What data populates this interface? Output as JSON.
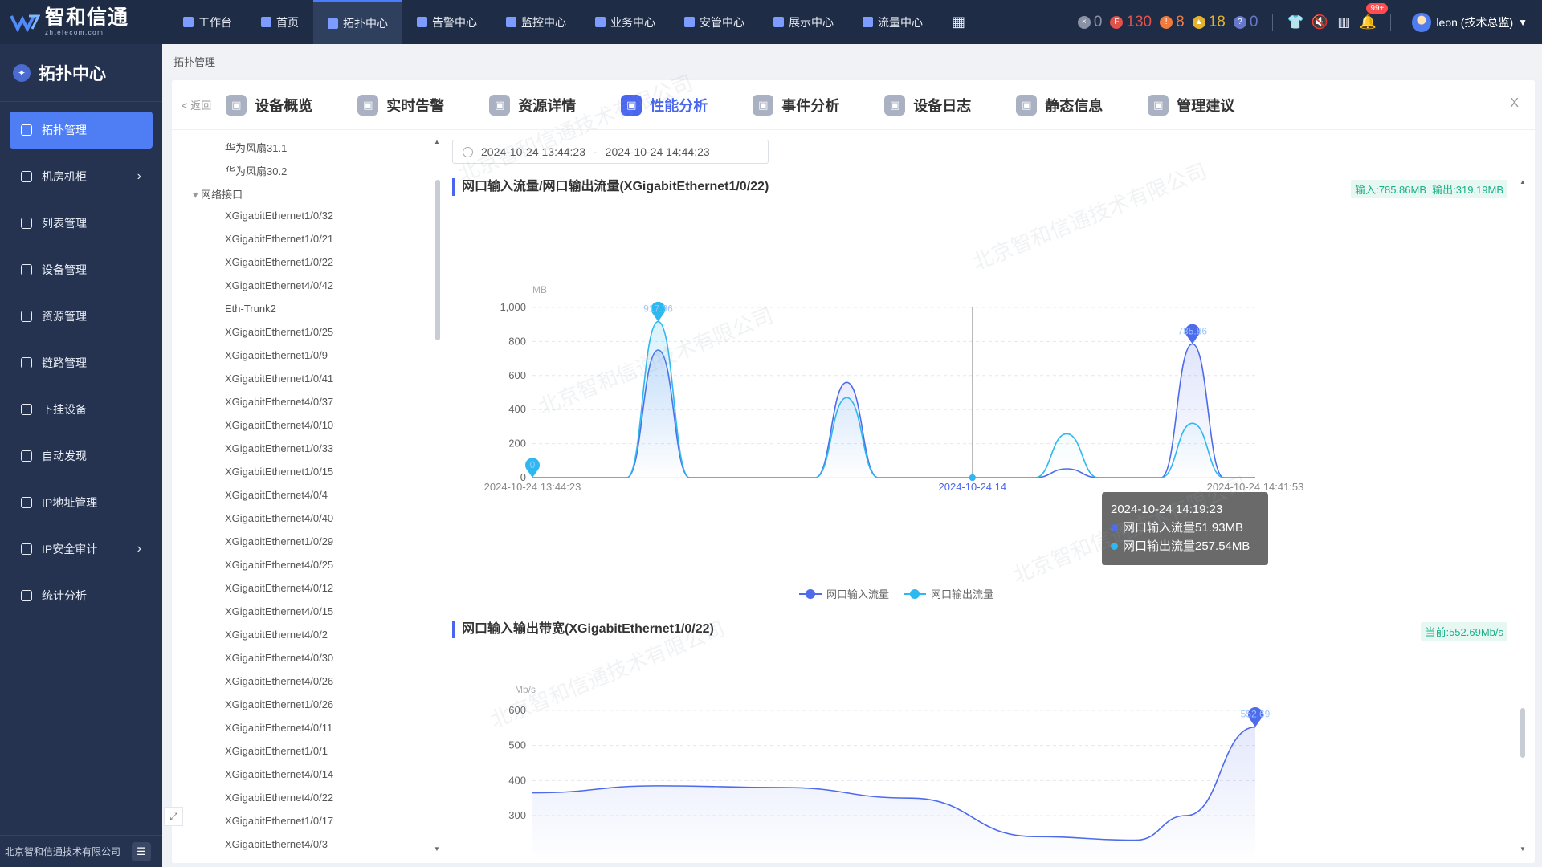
{
  "app": {
    "logo_cn": "智和信通",
    "logo_en": "zhtelecom.com"
  },
  "nav": [
    {
      "label": "工作台",
      "icon": "home-icon"
    },
    {
      "label": "首页",
      "icon": "home-icon"
    },
    {
      "label": "拓扑中心",
      "icon": "topology-icon",
      "active": true
    },
    {
      "label": "告警中心",
      "icon": "alert-icon"
    },
    {
      "label": "监控中心",
      "icon": "monitor-icon"
    },
    {
      "label": "业务中心",
      "icon": "business-icon"
    },
    {
      "label": "安管中心",
      "icon": "shield-icon"
    },
    {
      "label": "展示中心",
      "icon": "display-icon"
    },
    {
      "label": "流量中心",
      "icon": "traffic-icon"
    }
  ],
  "counters": [
    {
      "value": "0",
      "color": "#8a93a6",
      "icon": "×"
    },
    {
      "value": "130",
      "color": "#e0524b",
      "icon": "F"
    },
    {
      "value": "8",
      "color": "#f07b3f",
      "icon": "!"
    },
    {
      "value": "18",
      "color": "#e3b32f",
      "icon": "▲"
    },
    {
      "value": "0",
      "color": "#6878c8",
      "icon": "?"
    }
  ],
  "top_icons": {
    "notify_badge": "99+"
  },
  "user": {
    "name": "leon (技术总监)"
  },
  "sidebar": {
    "title": "拓扑中心",
    "items": [
      {
        "label": "拓扑管理",
        "active": true
      },
      {
        "label": "机房机柜",
        "chevron": true
      },
      {
        "label": "列表管理"
      },
      {
        "label": "设备管理"
      },
      {
        "label": "资源管理"
      },
      {
        "label": "链路管理"
      },
      {
        "label": "下挂设备"
      },
      {
        "label": "自动发现"
      },
      {
        "label": "IP地址管理"
      },
      {
        "label": "IP安全审计",
        "chevron": true
      },
      {
        "label": "统计分析"
      }
    ],
    "footer": "北京智和信通技术有限公司"
  },
  "breadcrumb": "拓扑管理",
  "panel": {
    "back": "< 返回",
    "close": "X",
    "tabs": [
      {
        "label": "设备概览"
      },
      {
        "label": "实时告警"
      },
      {
        "label": "资源详情"
      },
      {
        "label": "性能分析",
        "active": true
      },
      {
        "label": "事件分析"
      },
      {
        "label": "设备日志"
      },
      {
        "label": "静态信息"
      },
      {
        "label": "管理建议"
      }
    ]
  },
  "tree": {
    "before": [
      "华为风扇31.1",
      "华为风扇30.2"
    ],
    "group": "网络接口",
    "items": [
      "XGigabitEthernet1/0/32",
      "XGigabitEthernet1/0/21",
      "XGigabitEthernet1/0/22",
      "XGigabitEthernet4/0/42",
      "Eth-Trunk2",
      "XGigabitEthernet1/0/25",
      "XGigabitEthernet1/0/9",
      "XGigabitEthernet1/0/41",
      "XGigabitEthernet4/0/37",
      "XGigabitEthernet4/0/10",
      "XGigabitEthernet1/0/33",
      "XGigabitEthernet1/0/15",
      "XGigabitEthernet4/0/4",
      "XGigabitEthernet4/0/40",
      "XGigabitEthernet1/0/29",
      "XGigabitEthernet4/0/25",
      "XGigabitEthernet4/0/12",
      "XGigabitEthernet4/0/15",
      "XGigabitEthernet4/0/2",
      "XGigabitEthernet4/0/30",
      "XGigabitEthernet4/0/26",
      "XGigabitEthernet1/0/26",
      "XGigabitEthernet4/0/11",
      "XGigabitEthernet1/0/1",
      "XGigabitEthernet4/0/14",
      "XGigabitEthernet4/0/22",
      "XGigabitEthernet1/0/17",
      "XGigabitEthernet4/0/3"
    ]
  },
  "date_range": {
    "start": "2024-10-24 13:44:23",
    "sep": "-",
    "end": "2024-10-24 14:44:23"
  },
  "chart1": {
    "title": "网口输入流量/网口输出流量(XGigabitEthernet1/0/22)",
    "tag_in": "输入:785.86MB",
    "tag_out": "输出:319.19MB",
    "tooltip": {
      "time": "2024-10-24 14:19:23",
      "in": "网口输入流量51.93MB",
      "out": "网口输出流量257.54MB"
    },
    "legend": [
      "网口输入流量",
      "网口输出流量"
    ]
  },
  "chart2": {
    "title": "网口输入输出带宽(XGigabitEthernet1/0/22)",
    "tag": "当前:552.69Mb/s"
  },
  "chart_data": [
    {
      "type": "line",
      "title": "网口输入流量/网口输出流量(XGigabitEthernet1/0/22)",
      "ylabel": "MB",
      "ylim": [
        0,
        1000
      ],
      "yticks": [
        0,
        200,
        400,
        600,
        800,
        1000
      ],
      "ytick_labels": [
        "0",
        "200",
        "400",
        "600",
        "800",
        "1,000"
      ],
      "x_start": "2024-10-24 13:44:23",
      "x_end": "2024-10-24 14:41:53",
      "x_labels": [
        "2024-10-24 13:44:23",
        "2024-10-24 14:19:23",
        "2024-10-24 14:41:53"
      ],
      "x_label_visible": [
        "2024-10-24 13:44:23",
        "2024-10-24 14",
        "2024-10-24 14:41:53"
      ],
      "x_minutes": [
        0,
        2.5,
        5,
        7.5,
        10,
        12.5,
        15,
        17.5,
        20,
        22.5,
        25,
        27.5,
        30,
        32.5,
        35,
        37.5,
        40,
        42.5,
        45,
        47.5,
        50,
        52.5,
        55,
        57.5
      ],
      "series": [
        {
          "name": "网口输入流量",
          "color": "#4d6bea",
          "values": [
            0,
            0,
            0,
            0,
            750,
            0,
            0,
            0,
            0,
            0,
            560,
            0,
            0,
            0,
            0,
            0,
            0,
            51.93,
            0,
            0,
            0,
            785.86,
            0,
            0
          ]
        },
        {
          "name": "网口输出流量",
          "color": "#2eb8f0",
          "values": [
            0,
            0,
            0,
            0,
            917.36,
            0,
            0,
            0,
            0,
            0,
            470,
            0,
            0,
            0,
            0,
            0,
            0,
            257.54,
            0,
            0,
            0,
            319.19,
            0,
            0
          ]
        }
      ],
      "markers": [
        {
          "label": "917.36"
        },
        {
          "label": "0"
        },
        {
          "label": "785.86"
        }
      ],
      "tooltip_x": "2024-10-24 14:19:23",
      "legend": "bottom-center"
    },
    {
      "type": "line",
      "title": "网口输入输出带宽(XGigabitEthernet1/0/22)",
      "ylabel": "Mb/s",
      "ylim": [
        300,
        600
      ],
      "yticks": [
        300,
        400,
        500,
        600
      ],
      "ytick_labels": [
        "300",
        "400",
        "500",
        "600"
      ],
      "x_minutes": [
        0,
        10,
        20,
        30,
        40,
        48,
        52,
        57.5
      ],
      "series": [
        {
          "name": "",
          "color": "#4d6bea",
          "values": [
            365,
            385,
            380,
            350,
            240,
            230,
            300,
            552.69
          ]
        }
      ],
      "markers": [
        {
          "label": "552.69"
        }
      ]
    }
  ]
}
